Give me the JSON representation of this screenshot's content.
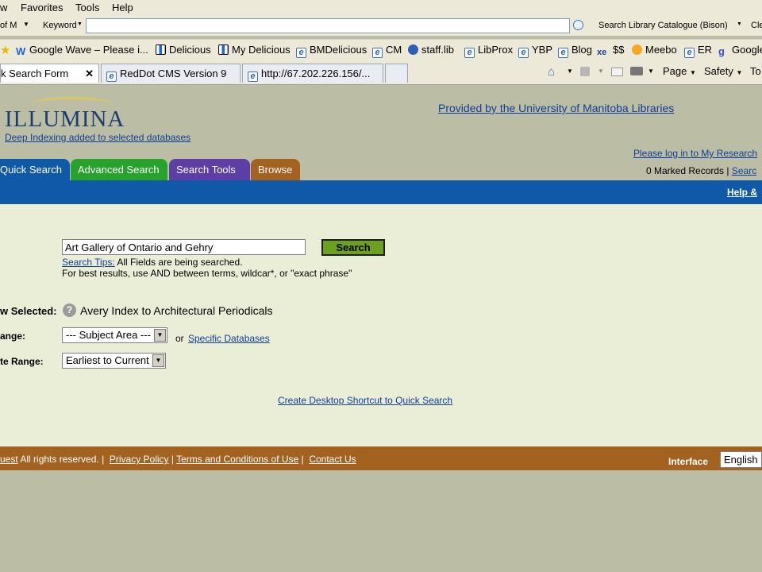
{
  "menu": {
    "items": [
      "w",
      "Favorites",
      "Tools",
      "Help"
    ]
  },
  "toolbar": {
    "left_label": "of M",
    "keyword_label": "Keyword",
    "address_value": "",
    "search_engine_label": "Search Library Catalogue (Bison)",
    "right_label": "Cle"
  },
  "favorites": [
    "Google Wave – Please i...",
    "Delicious",
    "My Delicious",
    "BMDelicious",
    "CM",
    "staff.lib",
    "LibProx",
    "YBP",
    "Blog",
    "$$",
    "Meebo",
    "ER",
    "Google"
  ],
  "browser_tabs": [
    {
      "label": "k Search Form"
    },
    {
      "label": "RedDot CMS Version 9"
    },
    {
      "label": "http://67.202.226.156/..."
    }
  ],
  "commands": {
    "page": "Page",
    "safety": "Safety",
    "tools": "To"
  },
  "page": {
    "logo": "ILLUMINA",
    "deep_indexing": "Deep Indexing added to selected databases",
    "provider": "Provided by the University of Manitoba Libraries",
    "login": "Please log in to My Research",
    "marked_records": "0 Marked Records",
    "search_history": "Searc",
    "help": "Help &",
    "tabs": [
      "Quick Search",
      "Advanced Search",
      "Search Tools",
      "Browse"
    ],
    "tab_colors": [
      "#1059a9",
      "#27a22c",
      "#5c3ea5",
      "#a3621f"
    ],
    "search_value": "Art Gallery of Ontario and Gehry",
    "search_button": "Search",
    "search_tips_link": "Search Tips:",
    "search_tips_text": "All Fields are being searched.",
    "best_results": "For best results, use AND between terms, wildcar*, or \"exact phrase\"",
    "now_selected_label": "w Selected:",
    "now_selected_value": "Avery Index to Architectural Periodicals",
    "range_label": "ange:",
    "subject_area": "--- Subject Area ---",
    "or_text": "or",
    "specific_db_link": "Specific Databases",
    "date_range_label": "te Range:",
    "date_range_value": "Earliest to Current",
    "desktop_shortcut": "Create Desktop Shortcut to Quick Search"
  },
  "footer": {
    "rights_link": "uest",
    "rights_text": "All rights reserved.",
    "privacy": "Privacy Policy",
    "terms": "Terms and Conditions of Use",
    "contact": "Contact Us",
    "interface_label": "Interface",
    "language": "English"
  }
}
